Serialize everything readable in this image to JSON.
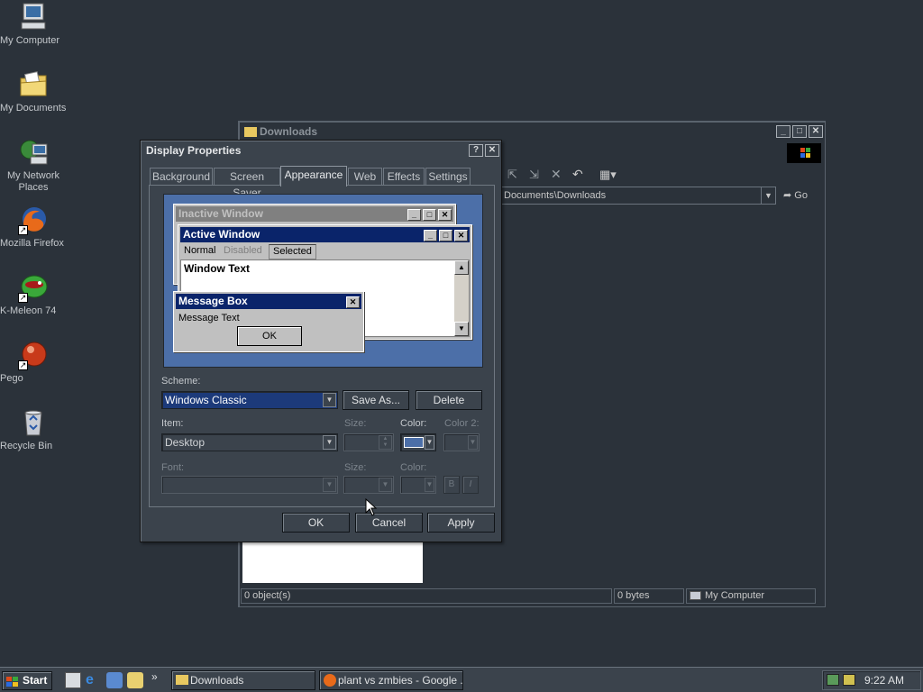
{
  "desktop": {
    "icons": [
      {
        "label": "My Computer",
        "icon": "computer-icon"
      },
      {
        "label": "My Documents",
        "icon": "folder-documents-icon"
      },
      {
        "label": "My Network Places",
        "icon": "network-places-icon"
      },
      {
        "label": "Mozilla Firefox",
        "icon": "firefox-icon"
      },
      {
        "label": "K-Meleon 74",
        "icon": "kmeleon-icon"
      },
      {
        "label": "Pego",
        "icon": "pego-icon"
      },
      {
        "label": "Recycle Bin",
        "icon": "recycle-bin-icon"
      }
    ]
  },
  "explorer": {
    "title": "Downloads",
    "address": "Documents\\Downloads",
    "go_label": "Go",
    "status": {
      "objects": "0 object(s)",
      "size": "0 bytes",
      "location": "My Computer"
    }
  },
  "dialog": {
    "title": "Display Properties",
    "help_btn": "?",
    "close_btn": "✕",
    "tabs": [
      "Background",
      "Screen Saver",
      "Appearance",
      "Web",
      "Effects",
      "Settings"
    ],
    "active_tab": "Appearance",
    "preview": {
      "inactive_title": "Inactive Window",
      "active_title": "Active Window",
      "menu": {
        "normal": "Normal",
        "disabled": "Disabled",
        "selected": "Selected"
      },
      "window_text": "Window Text",
      "msgbox_title": "Message Box",
      "msgbox_text": "Message Text",
      "msgbox_ok": "OK"
    },
    "scheme_label": "Scheme:",
    "scheme_value": "Windows Classic",
    "save_as_label": "Save As...",
    "delete_label": "Delete",
    "item_label": "Item:",
    "item_value": "Desktop",
    "size_label": "Size:",
    "color_label": "Color:",
    "color2_label": "Color 2:",
    "font_label": "Font:",
    "font_size_label": "Size:",
    "font_color_label": "Color:",
    "bold_label": "B",
    "italic_label": "I",
    "ok_label": "OK",
    "cancel_label": "Cancel",
    "apply_label": "Apply"
  },
  "taskbar": {
    "start_label": "Start",
    "chevron": "»",
    "tasks": [
      {
        "label": "Downloads",
        "icon": "folder-icon"
      },
      {
        "label": "plant vs zmbies - Google ...",
        "icon": "firefox-icon"
      }
    ],
    "clock": "9:22 AM"
  },
  "colors": {
    "desktop": "#2b323a",
    "window_face": "#3b434c",
    "active_title": "#0a246a",
    "inactive_title": "#808080",
    "preview_desktop": "#4c6fa8",
    "selection": "#1c3a7a"
  }
}
